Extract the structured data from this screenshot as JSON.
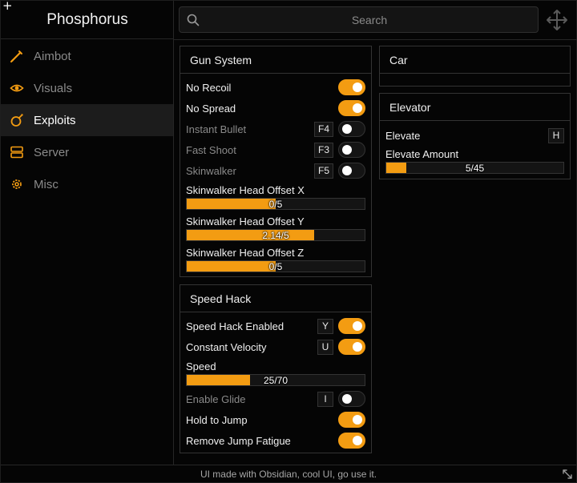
{
  "app": {
    "title": "Phosphorus"
  },
  "accent": "#f39c12",
  "sidebar": {
    "items": [
      {
        "label": "Aimbot",
        "icon": "crosshair-pen-icon",
        "active": false
      },
      {
        "label": "Visuals",
        "icon": "eye-icon",
        "active": false
      },
      {
        "label": "Exploits",
        "icon": "bomb-icon",
        "active": true
      },
      {
        "label": "Server",
        "icon": "server-icon",
        "active": false
      },
      {
        "label": "Misc",
        "icon": "gear-icon",
        "active": false
      }
    ]
  },
  "search": {
    "placeholder": "Search",
    "value": ""
  },
  "gun_system": {
    "title": "Gun System",
    "toggles": [
      {
        "label": "No Recoil",
        "on": true,
        "key": ""
      },
      {
        "label": "No Spread",
        "on": true,
        "key": ""
      },
      {
        "label": "Instant Bullet",
        "on": false,
        "key": "F4"
      },
      {
        "label": "Fast Shoot",
        "on": false,
        "key": "F3"
      },
      {
        "label": "Skinwalker",
        "on": false,
        "key": "F5"
      }
    ],
    "sliders": [
      {
        "label": "Skinwalker Head Offset X",
        "text": "0/5",
        "value": 0,
        "min": -5,
        "max": 5
      },
      {
        "label": "Skinwalker Head Offset Y",
        "text": "2.14/5",
        "value": 2.14,
        "min": -5,
        "max": 5
      },
      {
        "label": "Skinwalker Head Offset Z",
        "text": "0/5",
        "value": 0,
        "min": -5,
        "max": 5
      }
    ]
  },
  "speed_hack": {
    "title": "Speed Hack",
    "hack_enabled": {
      "label": "Speed Hack Enabled",
      "on": true,
      "key": "Y"
    },
    "constant_velocity": {
      "label": "Constant Velocity",
      "on": true,
      "key": "U"
    },
    "speed": {
      "label": "Speed",
      "text": "25/70",
      "value": 25,
      "min": 0,
      "max": 70
    },
    "enable_glide": {
      "label": "Enable Glide",
      "on": false,
      "key": "I"
    },
    "hold_to_jump": {
      "label": "Hold to Jump",
      "on": true,
      "key": ""
    },
    "remove_jump_fatigue": {
      "label": "Remove Jump Fatigue",
      "on": true,
      "key": ""
    }
  },
  "car": {
    "title": "Car"
  },
  "elevator": {
    "title": "Elevator",
    "elevate": {
      "label": "Elevate",
      "key": "H"
    },
    "amount": {
      "label": "Elevate Amount",
      "text": "5/45",
      "value": 5,
      "min": 0,
      "max": 45
    }
  },
  "footer": {
    "text": "UI made with Obsidian, cool UI, go use it."
  }
}
